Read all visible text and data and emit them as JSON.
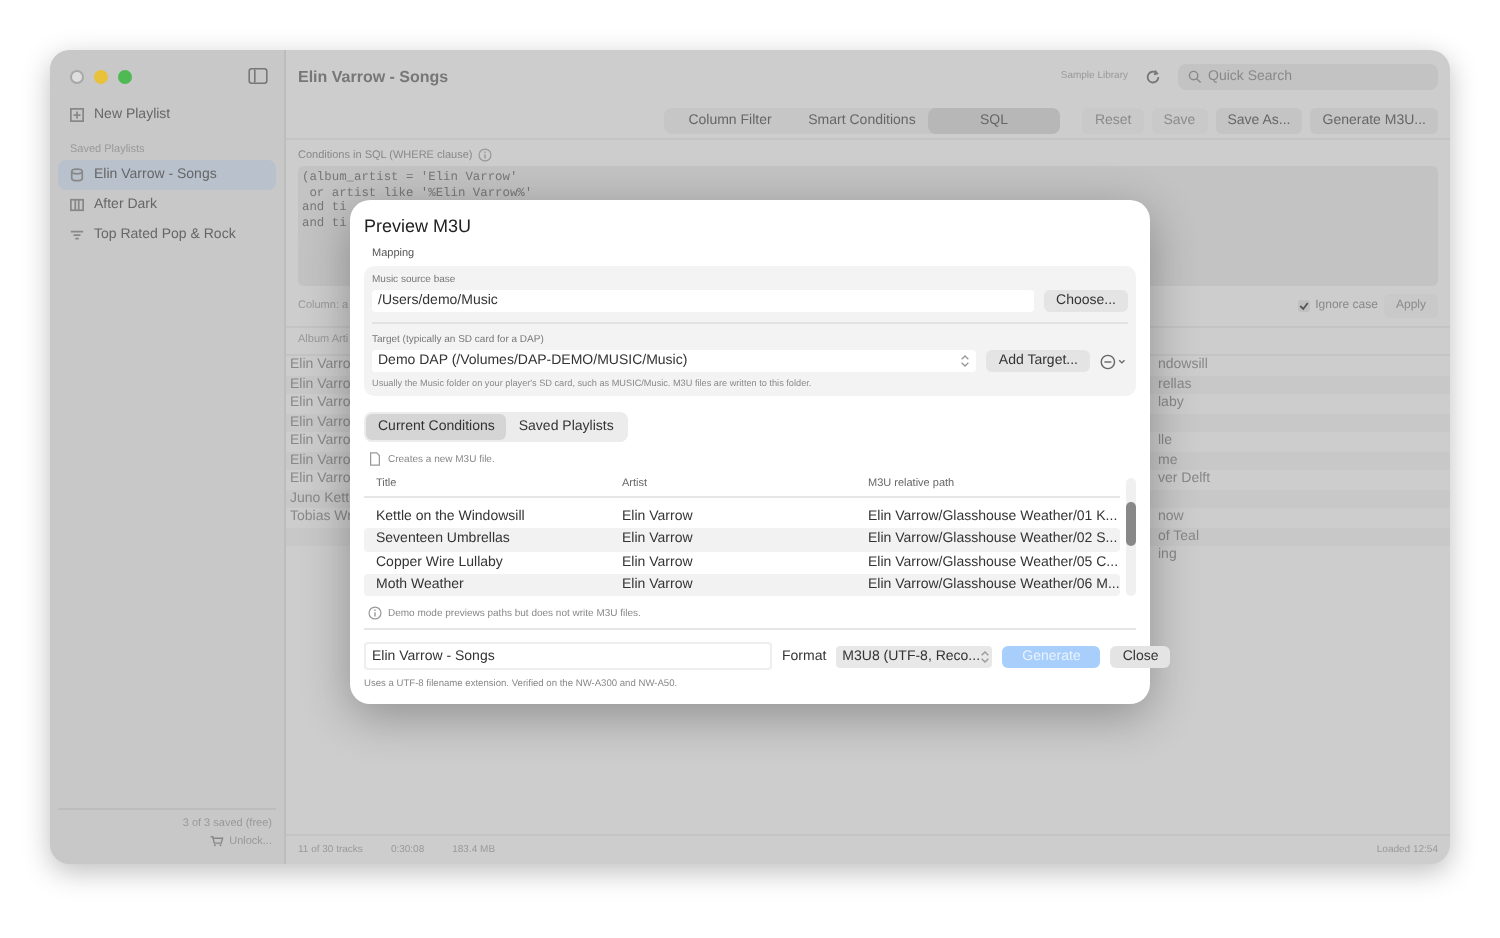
{
  "window": {
    "title": "Elin Varrow - Songs",
    "library": "Sample Library",
    "search": {
      "placeholder": "Quick Search"
    }
  },
  "sidebar": {
    "new_playlist": "New Playlist",
    "section": "Saved Playlists",
    "items": [
      {
        "label": "Elin Varrow - Songs",
        "selected": true,
        "kind": "songs"
      },
      {
        "label": "After Dark",
        "selected": false,
        "kind": "columns"
      },
      {
        "label": "Top Rated Pop & Rock",
        "selected": false,
        "kind": "filter"
      }
    ],
    "footer": {
      "count": "3 of 3 saved (free)",
      "unlock": "Unlock..."
    }
  },
  "mode_tabs": [
    {
      "label": "Column Filter",
      "selected": false
    },
    {
      "label": "Smart Conditions",
      "selected": false
    },
    {
      "label": "SQL",
      "selected": true
    }
  ],
  "toolbar_buttons": [
    {
      "label": "Reset",
      "disabled": true
    },
    {
      "label": "Save",
      "disabled": true
    },
    {
      "label": "Save As...",
      "disabled": false
    },
    {
      "label": "Generate M3U...",
      "disabled": false
    }
  ],
  "sql": {
    "label": "Conditions in SQL (WHERE clause)",
    "lines": [
      "(album_artist = 'Elin Varrow'",
      " or artist like '%Elin Varrow%'",
      "and ti",
      "and ti"
    ],
    "hint": "Column: a",
    "ignore_case": {
      "label": "Ignore case",
      "checked": true
    },
    "apply": {
      "label": "Apply",
      "disabled": true
    }
  },
  "tracks": {
    "column_1": "Album Arti",
    "rows": [
      {
        "column_1": "Elin Varro",
        "column_2": "ndowsill"
      },
      {
        "column_1": "Elin Varro",
        "column_2": "rellas"
      },
      {
        "column_1": "Elin Varro",
        "column_2": "laby"
      },
      {
        "column_1": "Elin Varro"
      },
      {
        "column_1": "Elin Varro",
        "column_2": "lle"
      },
      {
        "column_1": "Elin Varro",
        "column_2": "me"
      },
      {
        "column_1": "Elin Varro",
        "column_2": "ver Delft"
      },
      {
        "column_1": "Juno Kett"
      },
      {
        "column_1": "Tobias Wr",
        "column_2": "now"
      },
      {
        "column_2": "of Teal"
      },
      {
        "column_2": "ing"
      }
    ]
  },
  "status_bar": {
    "tracks": "11 of 30 tracks",
    "duration": "0:30:08",
    "size": "183.4 MB",
    "loaded": "Loaded 12:54"
  },
  "dialog": {
    "title": "Preview M3U",
    "section": "Mapping",
    "source": {
      "label": "Music source base",
      "value": "/Users/demo/Music",
      "button": "Choose..."
    },
    "target": {
      "label": "Target (typically an SD card for a DAP)",
      "value": "Demo DAP (/Volumes/DAP-DEMO/MUSIC/Music)",
      "button": "Add Target...",
      "hint": "Usually the Music folder on your player's SD card, such as MUSIC/Music. M3U files are written to this folder."
    },
    "tabs": [
      {
        "label": "Current Conditions",
        "selected": true
      },
      {
        "label": "Saved Playlists",
        "selected": false
      }
    ],
    "creates_note": "Creates a new M3U file.",
    "table": {
      "columns": [
        "Title",
        "Artist",
        "M3U relative path"
      ],
      "rows": [
        [
          "Kettle on the Windowsill",
          "Elin Varrow",
          "Elin Varrow/Glasshouse Weather/01 K..."
        ],
        [
          "Seventeen Umbrellas",
          "Elin Varrow",
          "Elin Varrow/Glasshouse Weather/02 S..."
        ],
        [
          "Copper Wire Lullaby",
          "Elin Varrow",
          "Elin Varrow/Glasshouse Weather/05 C..."
        ],
        [
          "Moth Weather",
          "Elin Varrow",
          "Elin Varrow/Glasshouse Weather/06 M..."
        ]
      ]
    },
    "demo_note": "Demo mode previews paths but does not write M3U files.",
    "name": {
      "value": "Elin Varrow - Songs"
    },
    "format": {
      "label": "Format",
      "value": "M3U8 (UTF-8, Reco..."
    },
    "buttons": [
      {
        "label": "Generate",
        "disabled": true,
        "kind": "primary"
      },
      {
        "label": "Close",
        "disabled": false,
        "kind": "normal"
      }
    ],
    "footnote": "Uses a UTF-8 filename extension. Verified on the NW-A300 and NW-A50."
  }
}
